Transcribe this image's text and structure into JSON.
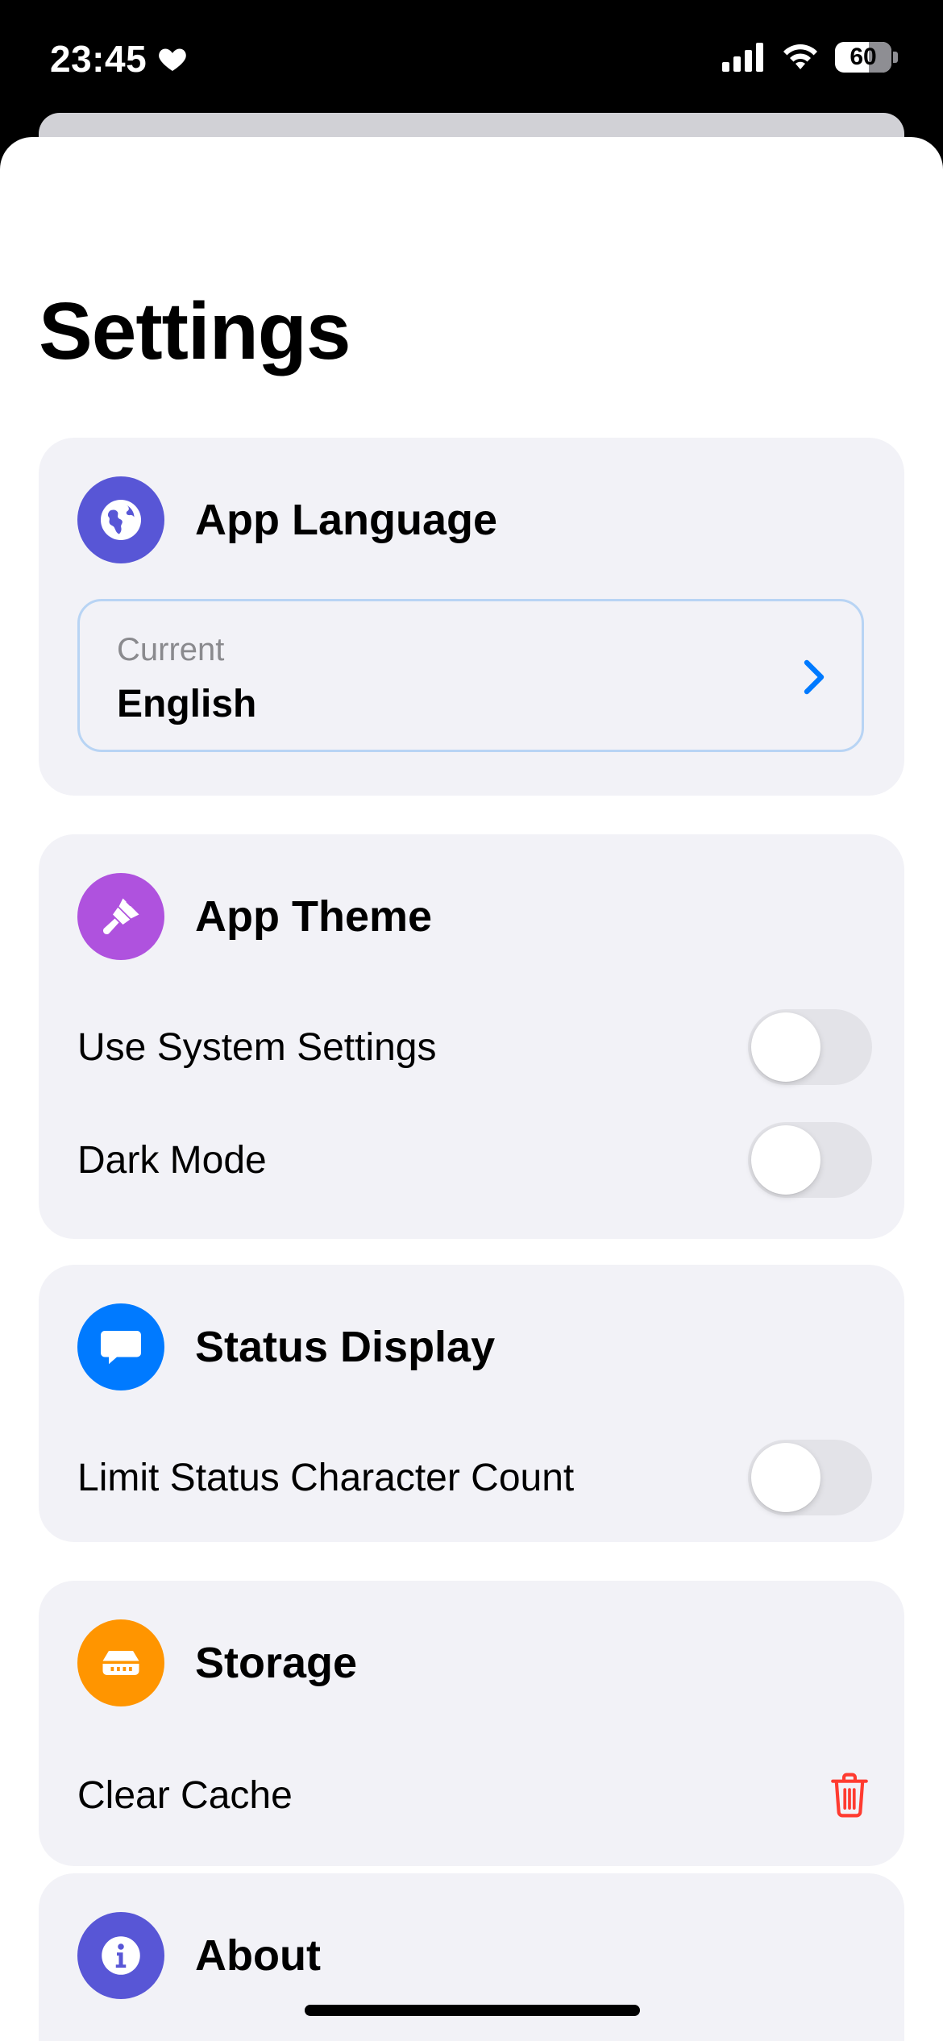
{
  "status_bar": {
    "time": "23:45",
    "battery": "60",
    "icons": [
      "heart-icon",
      "cellular-signal-icon",
      "wifi-icon",
      "battery-icon"
    ]
  },
  "title": "Settings",
  "colors": {
    "language_icon_bg": "#5856d6",
    "theme_icon_bg": "#af52de",
    "status_icon_bg": "#007aff",
    "storage_icon_bg": "#ff9500",
    "about_icon_bg": "#5856d6",
    "destructive": "#ff3b30",
    "accent": "#007aff"
  },
  "language": {
    "title": "App Language",
    "icon": "globe-icon",
    "current_caption": "Current",
    "current_value": "English"
  },
  "theme": {
    "title": "App Theme",
    "icon": "paintbrush-icon",
    "rows": [
      {
        "label": "Use System Settings",
        "on": false
      },
      {
        "label": "Dark Mode",
        "on": false
      }
    ]
  },
  "status_display": {
    "title": "Status Display",
    "icon": "message-bubble-icon",
    "rows": [
      {
        "label": "Limit Status Character Count",
        "on": false
      }
    ]
  },
  "storage": {
    "title": "Storage",
    "icon": "storage-drive-icon",
    "clear_cache": "Clear Cache"
  },
  "about": {
    "title": "About",
    "icon": "info-icon"
  }
}
